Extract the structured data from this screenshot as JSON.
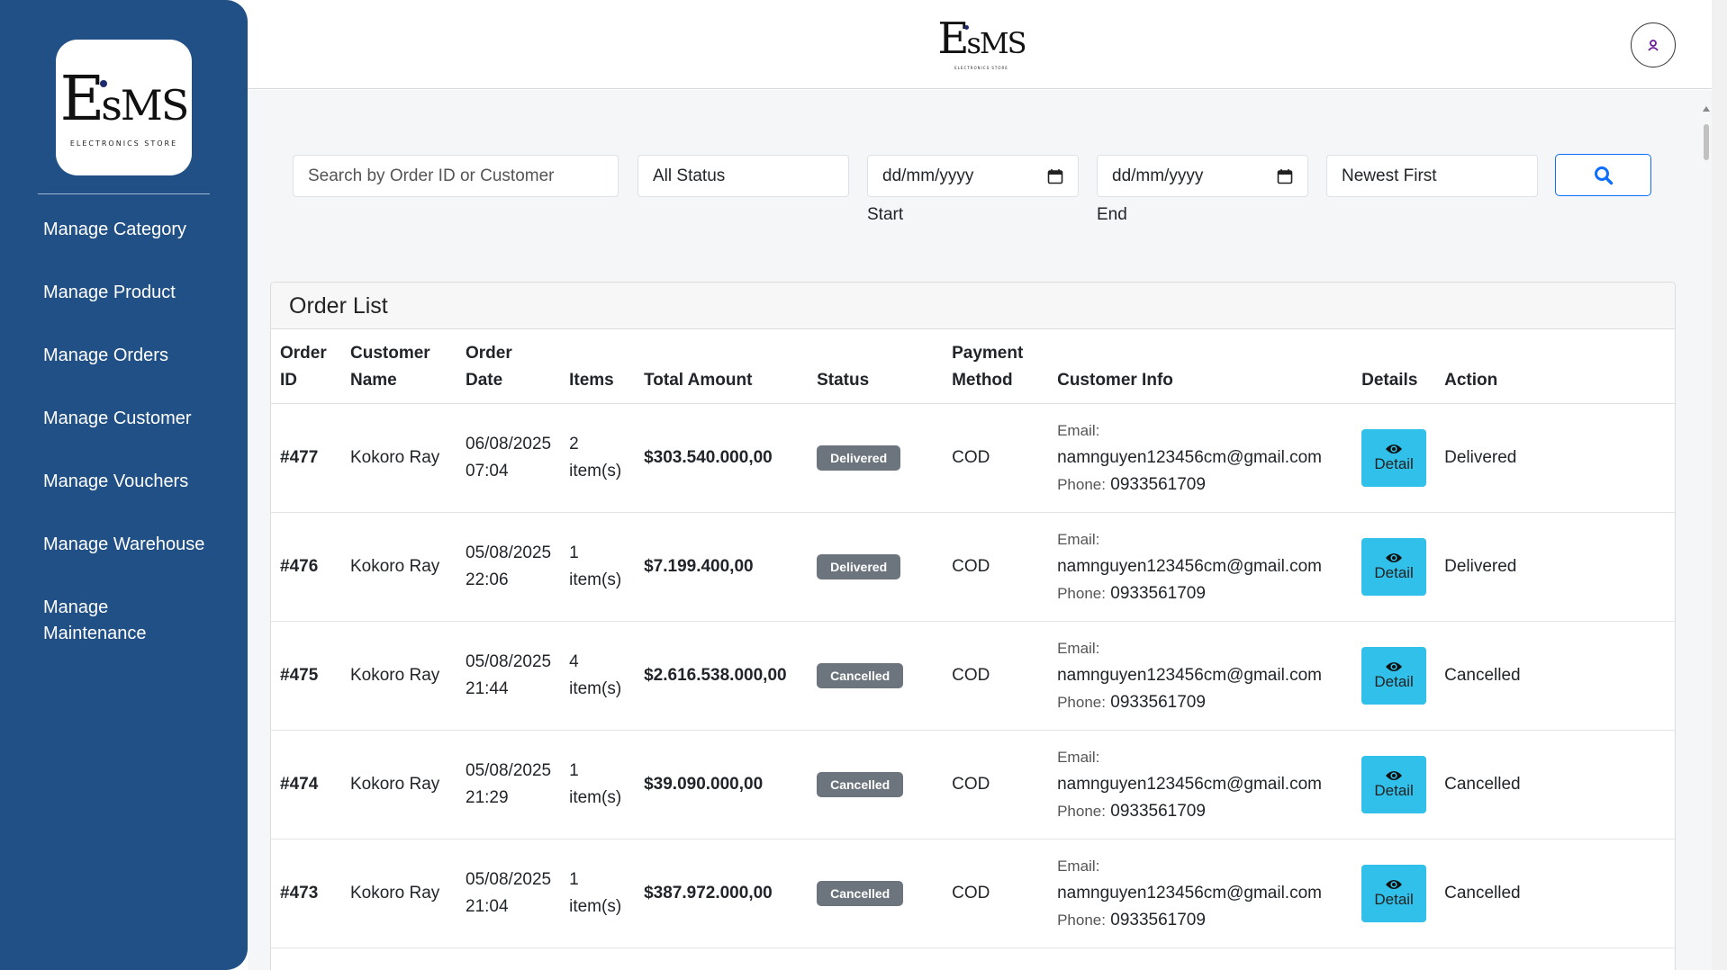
{
  "brand": {
    "logo_text": "EsMS",
    "logo_subtitle": "ELECTRONICS STORE"
  },
  "sidebar": {
    "items": [
      {
        "label": "Manage Category"
      },
      {
        "label": "Manage Product"
      },
      {
        "label": "Manage Orders"
      },
      {
        "label": "Manage Customer"
      },
      {
        "label": "Manage Vouchers"
      },
      {
        "label": "Manage Warehouse"
      },
      {
        "label": "Manage Maintenance"
      }
    ]
  },
  "header": {
    "avatar_icon": "user-icon"
  },
  "filters": {
    "search_placeholder": "Search by Order ID or Customer",
    "status_value": "All Status",
    "start_date_placeholder": "dd/mm/yyyy",
    "start_label": "Start",
    "end_date_placeholder": "dd/mm/yyyy",
    "end_label": "End",
    "sort_value": "Newest First",
    "search_icon": "search-icon"
  },
  "orders": {
    "title": "Order List",
    "columns": {
      "order_id": "Order ID",
      "customer_name": "Customer Name",
      "order_date": "Order Date",
      "items": "Items",
      "total_amount": "Total Amount",
      "status": "Status",
      "payment_method": "Payment Method",
      "customer_info": "Customer Info",
      "details": "Details",
      "action": "Action"
    },
    "email_label": "Email:",
    "phone_label": "Phone:",
    "detail_label": "Detail",
    "rows": [
      {
        "id": "#477",
        "customer": "Kokoro Ray",
        "date": "06/08/2025",
        "time": "07:04",
        "items_count": "2",
        "items_unit": "item(s)",
        "total": "$303.540.000,00",
        "status": "Delivered",
        "payment": "COD",
        "email": "namnguyen123456cm@gmail.com",
        "phone": "0933561709",
        "action": "Delivered"
      },
      {
        "id": "#476",
        "customer": "Kokoro Ray",
        "date": "05/08/2025",
        "time": "22:06",
        "items_count": "1",
        "items_unit": "item(s)",
        "total": "$7.199.400,00",
        "status": "Delivered",
        "payment": "COD",
        "email": "namnguyen123456cm@gmail.com",
        "phone": "0933561709",
        "action": "Delivered"
      },
      {
        "id": "#475",
        "customer": "Kokoro Ray",
        "date": "05/08/2025",
        "time": "21:44",
        "items_count": "4",
        "items_unit": "item(s)",
        "total": "$2.616.538.000,00",
        "status": "Cancelled",
        "payment": "COD",
        "email": "namnguyen123456cm@gmail.com",
        "phone": "0933561709",
        "action": "Cancelled"
      },
      {
        "id": "#474",
        "customer": "Kokoro Ray",
        "date": "05/08/2025",
        "time": "21:29",
        "items_count": "1",
        "items_unit": "item(s)",
        "total": "$39.090.000,00",
        "status": "Cancelled",
        "payment": "COD",
        "email": "namnguyen123456cm@gmail.com",
        "phone": "0933561709",
        "action": "Cancelled"
      },
      {
        "id": "#473",
        "customer": "Kokoro Ray",
        "date": "05/08/2025",
        "time": "21:04",
        "items_count": "1",
        "items_unit": "item(s)",
        "total": "$387.972.000,00",
        "status": "Cancelled",
        "payment": "COD",
        "email": "namnguyen123456cm@gmail.com",
        "phone": "0933561709",
        "action": "Cancelled"
      }
    ]
  },
  "colors": {
    "sidebar": "#215086",
    "accent": "#0d6efd",
    "detail_button": "#31c0ea",
    "badge": "#6c757d"
  }
}
